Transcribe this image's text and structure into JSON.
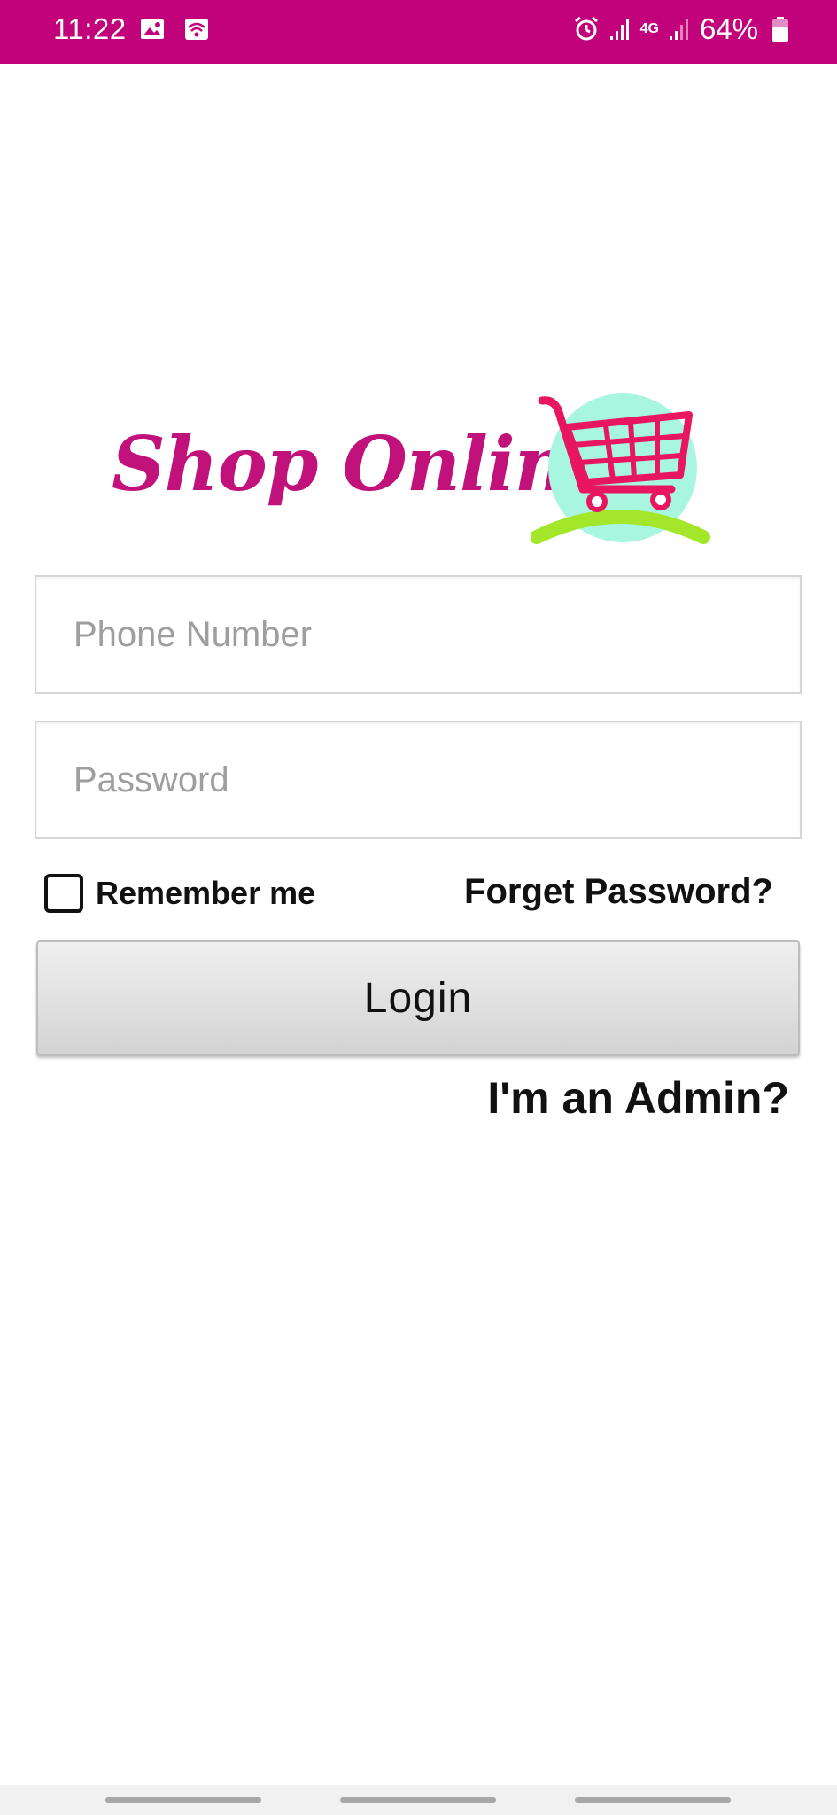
{
  "status_bar": {
    "time": "11:22",
    "network": "4G",
    "battery": "64%",
    "background_color": "#c2027a",
    "icons": [
      "image-icon",
      "wifi-icon",
      "alarm-icon",
      "signal-icon",
      "network-4g-icon",
      "signal-icon",
      "battery-icon"
    ]
  },
  "logo": {
    "text": "Shop Online",
    "text_color": "#c0127a",
    "icon": "shopping-cart-icon"
  },
  "form": {
    "phone_placeholder": "Phone Number",
    "password_placeholder": "Password",
    "remember_label": "Remember me",
    "remember_checked": false,
    "forget_password_label": "Forget Password?",
    "login_label": "Login",
    "admin_link_label": "I'm an Admin?"
  }
}
